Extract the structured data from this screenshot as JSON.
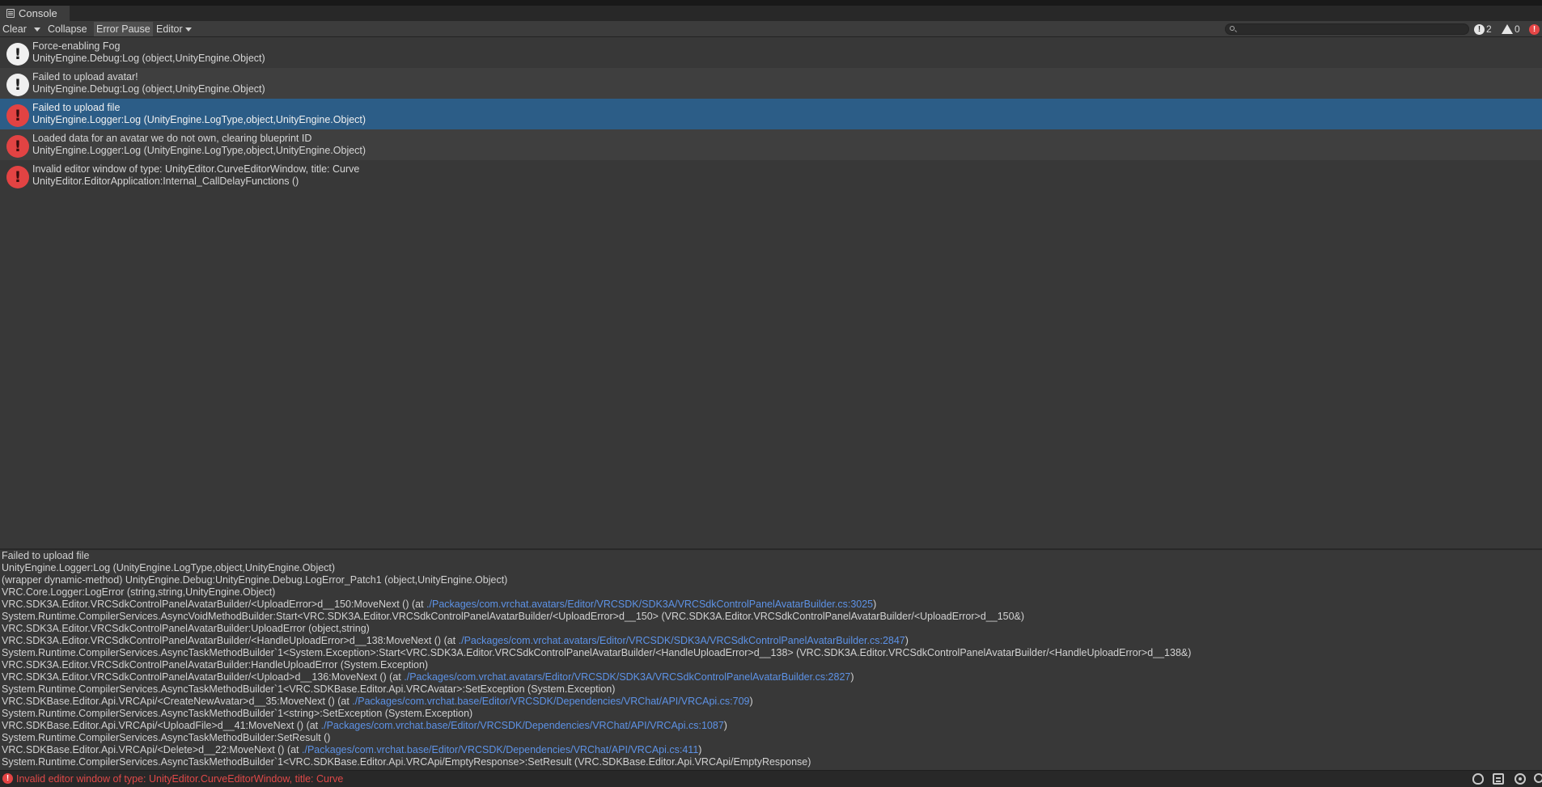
{
  "window": {
    "tab_title": "Console"
  },
  "toolbar": {
    "clear_label": "Clear",
    "collapse_label": "Collapse",
    "error_pause_label": "Error Pause",
    "editor_label": "Editor",
    "search_placeholder": "",
    "info_count": "2",
    "warning_count": "0",
    "error_count": ""
  },
  "log_entries": [
    {
      "type": "info",
      "message": "Force-enabling Fog",
      "source": "UnityEngine.Debug:Log (object,UnityEngine.Object)",
      "selected": false
    },
    {
      "type": "info",
      "message": "Failed to upload avatar!",
      "source": "UnityEngine.Debug:Log (object,UnityEngine.Object)",
      "selected": false
    },
    {
      "type": "error",
      "message": "Failed to upload file",
      "source": "UnityEngine.Logger:Log (UnityEngine.LogType,object,UnityEngine.Object)",
      "selected": true
    },
    {
      "type": "error",
      "message": "Loaded data for an avatar we do not own, clearing blueprint ID",
      "source": "UnityEngine.Logger:Log (UnityEngine.LogType,object,UnityEngine.Object)",
      "selected": false
    },
    {
      "type": "error",
      "message": "Invalid editor window of type: UnityEditor.CurveEditorWindow, title: Curve",
      "source": "UnityEditor.EditorApplication:Internal_CallDelayFunctions ()",
      "selected": false
    }
  ],
  "detail": {
    "lines": [
      {
        "text": "Failed to upload file",
        "link": "",
        "suffix": ""
      },
      {
        "text": "UnityEngine.Logger:Log (UnityEngine.LogType,object,UnityEngine.Object)",
        "link": "",
        "suffix": ""
      },
      {
        "text": "(wrapper dynamic-method) UnityEngine.Debug:UnityEngine.Debug.LogError_Patch1 (object,UnityEngine.Object)",
        "link": "",
        "suffix": ""
      },
      {
        "text": "VRC.Core.Logger:LogError (string,string,UnityEngine.Object)",
        "link": "",
        "suffix": ""
      },
      {
        "text": "VRC.SDK3A.Editor.VRCSdkControlPanelAvatarBuilder/<UploadError>d__150:MoveNext () (at ",
        "link": "./Packages/com.vrchat.avatars/Editor/VRCSDK/SDK3A/VRCSdkControlPanelAvatarBuilder.cs:3025",
        "suffix": ")"
      },
      {
        "text": "System.Runtime.CompilerServices.AsyncVoidMethodBuilder:Start<VRC.SDK3A.Editor.VRCSdkControlPanelAvatarBuilder/<UploadError>d__150> (VRC.SDK3A.Editor.VRCSdkControlPanelAvatarBuilder/<UploadError>d__150&)",
        "link": "",
        "suffix": ""
      },
      {
        "text": "VRC.SDK3A.Editor.VRCSdkControlPanelAvatarBuilder:UploadError (object,string)",
        "link": "",
        "suffix": ""
      },
      {
        "text": "VRC.SDK3A.Editor.VRCSdkControlPanelAvatarBuilder/<HandleUploadError>d__138:MoveNext () (at ",
        "link": "./Packages/com.vrchat.avatars/Editor/VRCSDK/SDK3A/VRCSdkControlPanelAvatarBuilder.cs:2847",
        "suffix": ")"
      },
      {
        "text": "System.Runtime.CompilerServices.AsyncTaskMethodBuilder`1<System.Exception>:Start<VRC.SDK3A.Editor.VRCSdkControlPanelAvatarBuilder/<HandleUploadError>d__138> (VRC.SDK3A.Editor.VRCSdkControlPanelAvatarBuilder/<HandleUploadError>d__138&)",
        "link": "",
        "suffix": ""
      },
      {
        "text": "VRC.SDK3A.Editor.VRCSdkControlPanelAvatarBuilder:HandleUploadError (System.Exception)",
        "link": "",
        "suffix": ""
      },
      {
        "text": "VRC.SDK3A.Editor.VRCSdkControlPanelAvatarBuilder/<Upload>d__136:MoveNext () (at ",
        "link": "./Packages/com.vrchat.avatars/Editor/VRCSDK/SDK3A/VRCSdkControlPanelAvatarBuilder.cs:2827",
        "suffix": ")"
      },
      {
        "text": "System.Runtime.CompilerServices.AsyncTaskMethodBuilder`1<VRC.SDKBase.Editor.Api.VRCAvatar>:SetException (System.Exception)",
        "link": "",
        "suffix": ""
      },
      {
        "text": "VRC.SDKBase.Editor.Api.VRCApi/<CreateNewAvatar>d__35:MoveNext () (at ",
        "link": "./Packages/com.vrchat.base/Editor/VRCSDK/Dependencies/VRChat/API/VRCApi.cs:709",
        "suffix": ")"
      },
      {
        "text": "System.Runtime.CompilerServices.AsyncTaskMethodBuilder`1<string>:SetException (System.Exception)",
        "link": "",
        "suffix": ""
      },
      {
        "text": "VRC.SDKBase.Editor.Api.VRCApi/<UploadFile>d__41:MoveNext () (at ",
        "link": "./Packages/com.vrchat.base/Editor/VRCSDK/Dependencies/VRChat/API/VRCApi.cs:1087",
        "suffix": ")"
      },
      {
        "text": "System.Runtime.CompilerServices.AsyncTaskMethodBuilder:SetResult ()",
        "link": "",
        "suffix": ""
      },
      {
        "text": "VRC.SDKBase.Editor.Api.VRCApi/<Delete>d__22:MoveNext () (at ",
        "link": "./Packages/com.vrchat.base/Editor/VRCSDK/Dependencies/VRChat/API/VRCApi.cs:411",
        "suffix": ")"
      },
      {
        "text": "System.Runtime.CompilerServices.AsyncTaskMethodBuilder`1<VRC.SDKBase.Editor.Api.VRCApi/EmptyResponse>:SetResult (VRC.SDKBase.Editor.Api.VRCApi/EmptyResponse)",
        "link": "",
        "suffix": ""
      }
    ]
  },
  "status_bar": {
    "message": "Invalid editor window of type: UnityEditor.CurveEditorWindow, title: Curve",
    "icons": [
      "bug-icon",
      "stack-icon",
      "visibility-icon",
      "ring-icon"
    ]
  },
  "colors": {
    "background": "#383838",
    "selected_row": "#2c5d87",
    "error_red": "#e24343",
    "link_blue": "#5d92e6"
  }
}
